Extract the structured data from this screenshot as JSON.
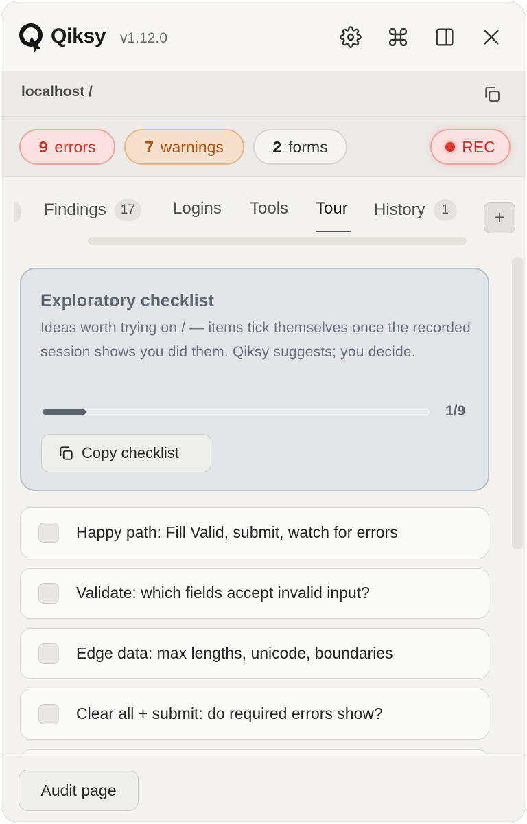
{
  "header": {
    "brand": "Qiksy",
    "version": "v1.12.0",
    "icons": [
      "settings-icon",
      "command-icon",
      "panel-icon",
      "close-icon"
    ]
  },
  "url": {
    "path": "localhost /"
  },
  "stats": {
    "errors": {
      "count": "9",
      "label": "errors"
    },
    "warnings": {
      "count": "7",
      "label": "warnings"
    },
    "forms": {
      "count": "2",
      "label": "forms"
    },
    "rec": "REC"
  },
  "tabs": [
    {
      "label": "Findings",
      "count": "17"
    },
    {
      "label": "Logins"
    },
    {
      "label": "Tools"
    },
    {
      "label": "Tour",
      "active": true
    },
    {
      "label": "History",
      "count": "1"
    }
  ],
  "add_tab": "+",
  "checklist": {
    "title": "Exploratory checklist",
    "description": "Ideas worth trying on / — items tick themselves once the recorded session shows you did them. Qiksy suggests; you decide.",
    "progress_text": "1/9",
    "progress_fraction": 0.111,
    "copy_label": "Copy checklist",
    "items": [
      "Happy path: Fill Valid, submit, watch for errors",
      "Validate: which fields accept invalid input?",
      "Edge data: max lengths, unicode, boundaries",
      "Clear all + submit: do required errors show?"
    ]
  },
  "footer": {
    "audit_label": "Audit page"
  },
  "colors": {
    "error": "#c8322a",
    "warning": "#b5520e",
    "accent_card": "#e3e5e8"
  }
}
